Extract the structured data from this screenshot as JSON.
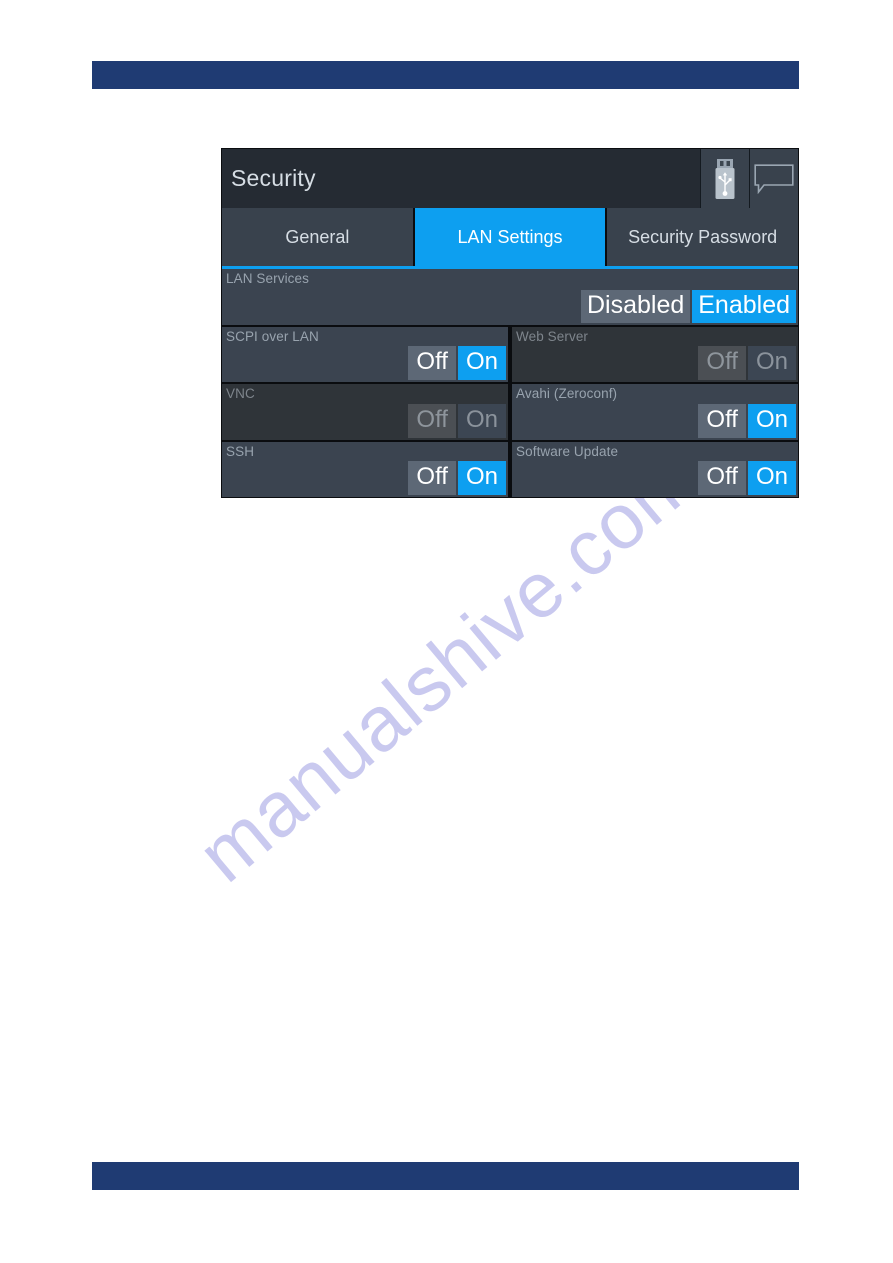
{
  "page": {
    "watermark": "manualshive.com",
    "header_bar_color": "#1f3b73",
    "footer_bar_color": "#1f3b73"
  },
  "device": {
    "title": "Security",
    "accent_color": "#0d9ff0",
    "panel_bg": "#3b4450",
    "titlebar_bg": "#252b33",
    "icons": [
      {
        "name": "usb-stick-icon",
        "label": "USB"
      },
      {
        "name": "message-bubble-icon",
        "label": "Messages"
      }
    ],
    "tabs": [
      {
        "label": "General",
        "active": false
      },
      {
        "label": "LAN Settings",
        "active": true
      },
      {
        "label": "Security Password",
        "active": false
      }
    ],
    "rows": [
      {
        "cells": [
          {
            "label": "LAN Services",
            "enabled": true,
            "options": [
              {
                "text": "Disabled",
                "selected": false
              },
              {
                "text": "Enabled",
                "selected": true
              }
            ]
          }
        ]
      },
      {
        "cells": [
          {
            "label": "SCPI over LAN",
            "enabled": true,
            "options": [
              {
                "text": "Off",
                "selected": false
              },
              {
                "text": "On",
                "selected": true
              }
            ]
          },
          {
            "label": "Web Server",
            "enabled": false,
            "options": [
              {
                "text": "Off",
                "selected": false
              },
              {
                "text": "On",
                "selected": false
              }
            ]
          }
        ]
      },
      {
        "cells": [
          {
            "label": "VNC",
            "enabled": false,
            "options": [
              {
                "text": "Off",
                "selected": false
              },
              {
                "text": "On",
                "selected": false
              }
            ]
          },
          {
            "label": "Avahi (Zeroconf)",
            "enabled": true,
            "options": [
              {
                "text": "Off",
                "selected": false
              },
              {
                "text": "On",
                "selected": true
              }
            ]
          }
        ]
      },
      {
        "cells": [
          {
            "label": "SSH",
            "enabled": true,
            "options": [
              {
                "text": "Off",
                "selected": false
              },
              {
                "text": "On",
                "selected": true
              }
            ]
          },
          {
            "label": "Software Update",
            "enabled": true,
            "options": [
              {
                "text": "Off",
                "selected": false
              },
              {
                "text": "On",
                "selected": true
              }
            ]
          }
        ]
      }
    ]
  }
}
